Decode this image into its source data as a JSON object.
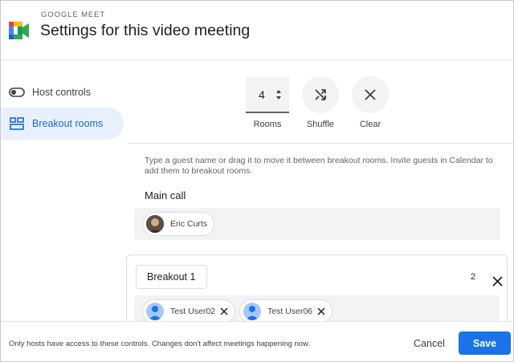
{
  "app": {
    "brand": "GOOGLE MEET",
    "title": "Settings for this video meeting"
  },
  "sidebar": {
    "items": [
      {
        "label": "Host controls",
        "icon": "toggle-icon",
        "active": false
      },
      {
        "label": "Breakout rooms",
        "icon": "breakout-rooms-icon",
        "active": true
      }
    ]
  },
  "controls": {
    "rooms_value": "4",
    "rooms_label": "Rooms",
    "shuffle_label": "Shuffle",
    "clear_label": "Clear"
  },
  "instructions": "Type a guest name or drag it to move it between breakout rooms. Invite guests in Calendar to add them to breakout rooms.",
  "main_call": {
    "heading": "Main call",
    "participants": [
      {
        "name": "Eric Curts"
      }
    ]
  },
  "breakout_rooms": [
    {
      "name": "Breakout 1",
      "count": "2",
      "participants": [
        {
          "name": "Test User02"
        },
        {
          "name": "Test User06"
        }
      ]
    }
  ],
  "footer": {
    "note": "Only hosts have access to these controls. Changes don't affect meetings happening now.",
    "cancel_label": "Cancel",
    "save_label": "Save"
  },
  "colors": {
    "accent": "#1a73e8",
    "active_bg": "#e8f0fe",
    "active_text": "#1967d2"
  }
}
